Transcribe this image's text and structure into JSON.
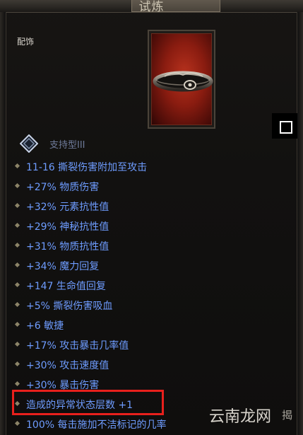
{
  "header": {
    "title": "试炼"
  },
  "item": {
    "category": "配饰",
    "icon": "belt-icon",
    "frame_color": "#b8321e"
  },
  "support": {
    "label": "支持型III",
    "icon": "diamond-icon"
  },
  "modifiers": [
    "11-16 撕裂伤害附加至攻击",
    "+27% 物质伤害",
    "+32% 元素抗性值",
    "+29% 神秘抗性值",
    "+31% 物质抗性值",
    "+34% 魔力回复",
    "+147 生命值回复",
    "+5% 撕裂伤害吸血",
    "+6 敏捷",
    "+17% 攻击暴击几率值",
    "+30% 攻击速度值",
    "+30% 暴击伤害",
    "造成的异常状态层数 +1",
    "100% 每击施加不洁标记的几率"
  ],
  "highlight": {
    "color": "#e8201c",
    "target": "造成的异常状态层数 +1"
  },
  "colors": {
    "mod_text": "#6e9cff",
    "support_text": "#6f7b9a"
  },
  "watermark": {
    "text": "云南龙网",
    "glyph": "揭"
  }
}
